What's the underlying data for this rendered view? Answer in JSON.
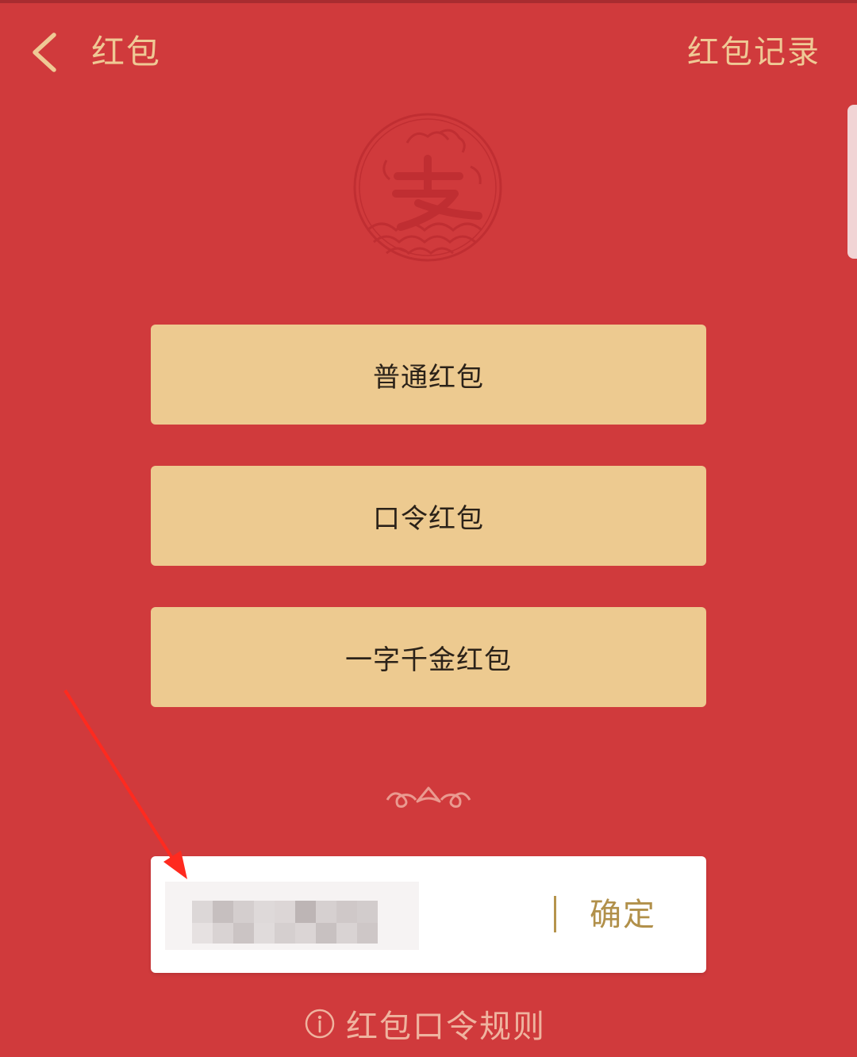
{
  "header": {
    "title": "红包",
    "record_label": "红包记录"
  },
  "options": [
    {
      "label": "普通红包"
    },
    {
      "label": "口令红包"
    },
    {
      "label": "一字千金红包"
    }
  ],
  "password_input": {
    "value": "",
    "confirm_label": "确定"
  },
  "rules_link": {
    "label": "红包口令规则"
  },
  "icons": {
    "back": "chevron-left-icon",
    "logo": "alipay-seal-icon",
    "divider": "ornamental-divider-icon",
    "info": "info-circle-icon",
    "annotation": "red-arrow-icon"
  },
  "colors": {
    "background": "#d03a3c",
    "button": "#edca90",
    "header_text": "#efc995",
    "confirm_text": "#b1904a",
    "rules_text": "#efb39f",
    "arrow": "#ff2a1f"
  }
}
